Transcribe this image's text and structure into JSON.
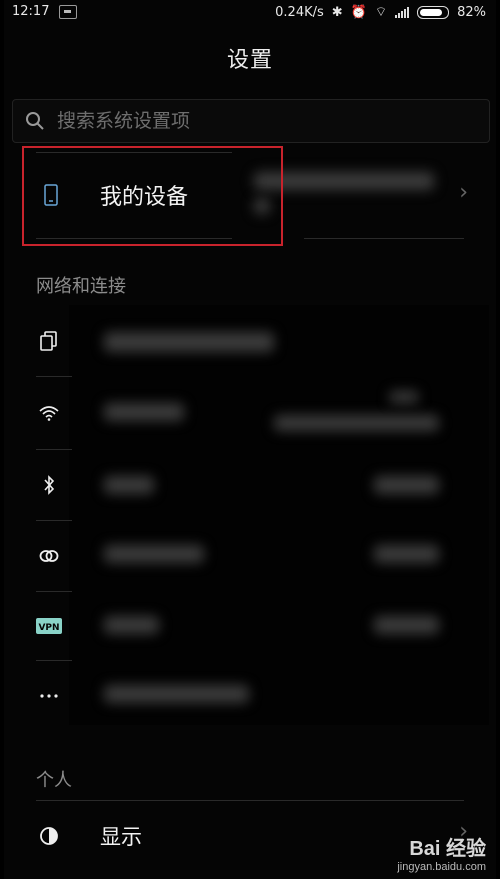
{
  "status_bar": {
    "time": "12:17",
    "net_speed": "0.24K/s",
    "battery": "82%"
  },
  "header": {
    "title": "设置"
  },
  "search": {
    "placeholder": "搜索系统设置项"
  },
  "my_device": {
    "label": "我的设备"
  },
  "sections": {
    "network": "网络和连接",
    "personal": "个人"
  },
  "personal_items": [
    {
      "label": "显示"
    }
  ],
  "watermark": {
    "brand": "Bai 经验",
    "url": "jingyan.baidu.com"
  },
  "colors": {
    "highlight": "#c8232c",
    "vpn_badge": "#8ad3c8"
  },
  "icons": [
    "search-icon",
    "phone-icon",
    "dual-sim-icon",
    "wifi-icon",
    "bluetooth-icon",
    "link-icon",
    "vpn-icon",
    "more-icon",
    "display-icon",
    "chevron-right-icon"
  ]
}
